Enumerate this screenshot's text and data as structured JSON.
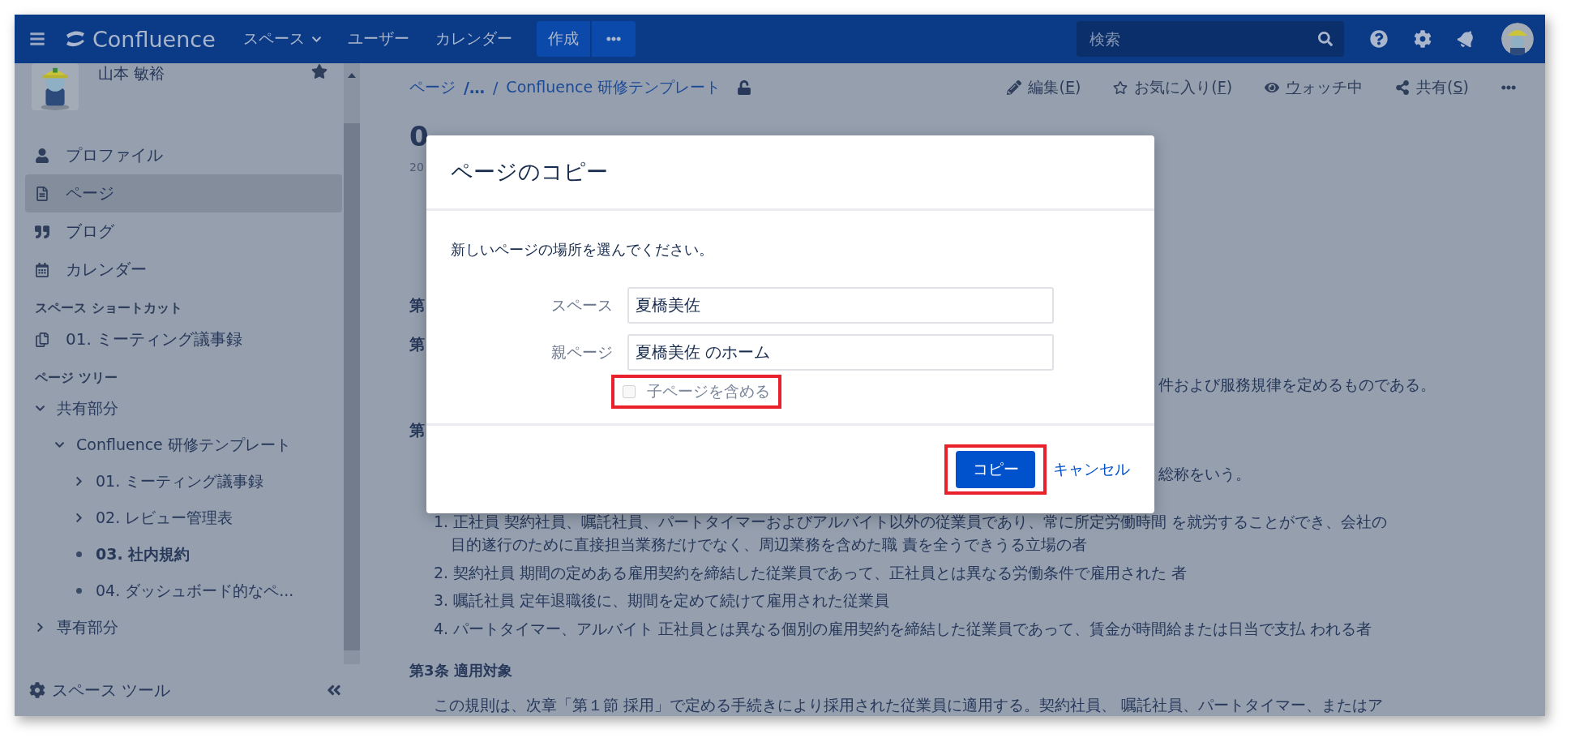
{
  "top_nav": {
    "logo": "Confluence",
    "links": [
      {
        "label": "スペース",
        "dropdown": true
      },
      {
        "label": "ユーザー",
        "dropdown": false
      },
      {
        "label": "カレンダー",
        "dropdown": false
      }
    ],
    "create": "作成",
    "search": {
      "placeholder": "検索"
    }
  },
  "sidebar": {
    "user": {
      "name": "山本 敏裕"
    },
    "nav": [
      {
        "label": "プロファイル",
        "selected": false
      },
      {
        "label": "ページ",
        "selected": true
      },
      {
        "label": "ブログ",
        "selected": false
      },
      {
        "label": "カレンダー",
        "selected": false
      }
    ],
    "shortcuts_heading": "スペース ショートカット",
    "shortcuts": [
      {
        "label": "01. ミーティング議事録"
      }
    ],
    "tree_heading": "ページ ツリー",
    "tree": [
      {
        "label": "共有部分",
        "expanded": true,
        "selected": false,
        "children": [
          {
            "label": "Confluence 研修テンプレート",
            "expanded": true,
            "selected": false,
            "children": [
              {
                "label": "01. ミーティング議事録",
                "expanded": false,
                "selected": false,
                "has_children": true
              },
              {
                "label": "02. レビュー管理表",
                "expanded": false,
                "selected": false,
                "has_children": true
              },
              {
                "label": "03. 社内規約",
                "expanded": false,
                "selected": true,
                "has_children": false
              },
              {
                "label": "04. ダッシュボード的なペ...",
                "expanded": false,
                "selected": false,
                "has_children": false
              }
            ]
          }
        ]
      },
      {
        "label": "専有部分",
        "expanded": false,
        "selected": false,
        "has_children": true
      }
    ],
    "tools": "スペース ツール"
  },
  "page": {
    "breadcrumb": [
      "ページ",
      "/…",
      "/",
      "Confluence 研修テンプレート"
    ],
    "actions": [
      {
        "prefix": "編集(",
        "key": "E",
        "suffix": ")"
      },
      {
        "prefix": "お気に入り(",
        "key": "F",
        "suffix": ")"
      },
      {
        "key": "ウ",
        "suffix": "ォッチ中"
      },
      {
        "prefix": "共有(",
        "key": "S",
        "suffix": ")"
      }
    ],
    "title": "0",
    "date": "20",
    "fragments": [
      {
        "left": "第"
      },
      {
        "left": "第"
      },
      {
        "right": "件および服務規律を定めるものである。"
      },
      {
        "left": "第"
      },
      {
        "right": "総称をいう。"
      }
    ],
    "list": [
      "1. 正社員 契約社員、嘱託社員、パートタイマーおよびアルバイト以外の従業員であり、常に所定労働時間 を就労することができ、会社の目的遂行のために直接担当業務だけでなく、周辺業務を含めた職 責を全うできうる立場の者",
      "2. 契約社員 期間の定めある雇用契約を締結した従業員であって、正社員とは異なる労働条件で雇用された 者",
      "3. 嘱託社員 定年退職後に、期間を定めて続けて雇用された従業員",
      "4. パートタイマー、アルバイト 正社員とは異なる個別の雇用契約を締結した従業員であって、賃金が時間給または日当で支払 われる者"
    ],
    "section": "第3条 適用対象",
    "section_text": "この規則は、次章「第１節 採用」で定める手続きにより採用された従業員に適用する。契約社員、 嘱託社員、パートタイマー、またはア"
  },
  "dialog": {
    "title": "ページのコピー",
    "prompt": "新しいページの場所を選んでください。",
    "fields": [
      {
        "label": "スペース",
        "value": "夏橋美佐"
      },
      {
        "label": "親ページ",
        "value": "夏橋美佐 のホーム"
      }
    ],
    "checkbox": {
      "label": "子ページを含める",
      "checked": false,
      "disabled": true,
      "highlighted": true
    },
    "primary": {
      "label": "コピー",
      "highlighted": true
    },
    "cancel": "キャンセル"
  }
}
